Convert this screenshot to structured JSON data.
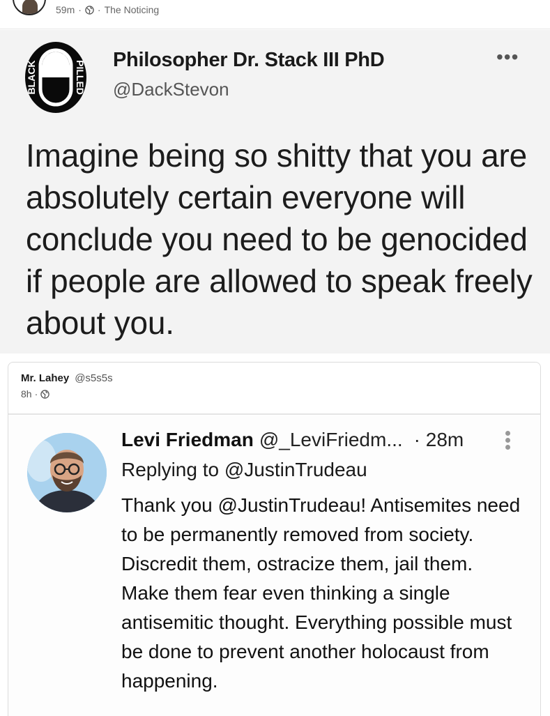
{
  "post": {
    "time": "59m",
    "separator1": "·",
    "separator2": "·",
    "community": "The Noticing",
    "globe_icon": "globe-icon"
  },
  "tweet_image": {
    "logo_text_left": "BLACK",
    "logo_text_right": "PILLED",
    "display_name": "Philosopher Dr. Stack III PhD",
    "handle": "@DackStevon",
    "more_label": "•••",
    "text": "Imagine being so shitty that you are absolutely certain everyone will conclude you need to be genocided if people are allowed to speak freely about you."
  },
  "quote": {
    "author_name": "Mr. Lahey",
    "author_handle": "@s5s5s",
    "time": "8h",
    "separator": "·"
  },
  "quoted_tweet_image": {
    "display_name": "Levi Friedman",
    "handle": "@_LeviFriedm...",
    "time": "· 28m",
    "replying_to": "Replying to @JustinTrudeau",
    "text": "Thank you @JustinTrudeau! Antisemites need to be permanently removed from society. Discredit them, ostracize them, jail them. Make them fear even thinking a single antisemitic thought. Everything possible must be done to prevent another holocaust from happening."
  }
}
